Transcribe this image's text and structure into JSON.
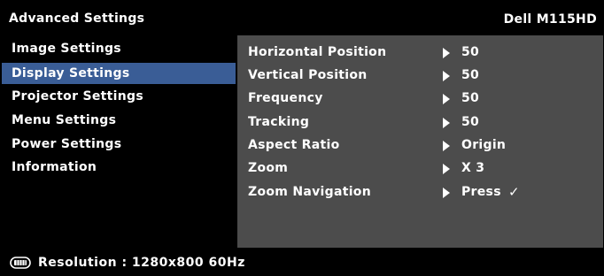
{
  "header": {
    "title": "Advanced Settings",
    "model": "Dell M115HD"
  },
  "menu": {
    "items": [
      {
        "label": "Image Settings"
      },
      {
        "label": "Display Settings"
      },
      {
        "label": "Projector Settings"
      },
      {
        "label": "Menu Settings"
      },
      {
        "label": "Power Settings"
      },
      {
        "label": "Information"
      }
    ],
    "active": "Display Settings"
  },
  "display_settings": {
    "rows": [
      {
        "label": "Horizontal Position",
        "value": "50"
      },
      {
        "label": "Vertical Position",
        "value": "50"
      },
      {
        "label": "Frequency",
        "value": "50"
      },
      {
        "label": "Tracking",
        "value": "50"
      },
      {
        "label": "Aspect Ratio",
        "value": "Origin"
      },
      {
        "label": "Zoom",
        "value": "X 3"
      },
      {
        "label": "Zoom Navigation",
        "value": "Press",
        "check": "✓"
      }
    ]
  },
  "status": {
    "resolution_icon": "monitor-icon",
    "resolution_text": "Resolution :  1280x800 60Hz"
  },
  "colors": {
    "active_item": "#3a5d96",
    "panel_bg": "#4c4c4c",
    "background": "#000000",
    "text": "#ffffff"
  }
}
